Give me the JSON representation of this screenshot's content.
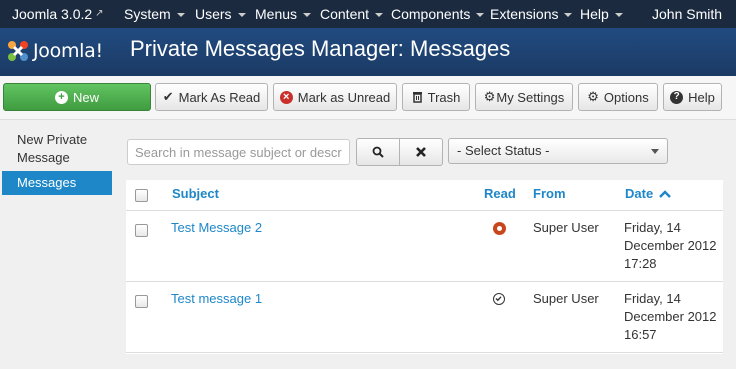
{
  "navbar": {
    "brand": "Joomla 3.0.2",
    "menus": [
      "System",
      "Users",
      "Menus",
      "Content",
      "Components",
      "Extensions",
      "Help"
    ],
    "user": "John Smith"
  },
  "header": {
    "logo_text": "Joomla!",
    "title": "Private Messages Manager: Messages"
  },
  "toolbar": {
    "new": "New",
    "mark_read": "Mark As Read",
    "mark_unread": "Mark as Unread",
    "trash": "Trash",
    "my_settings": "My Settings",
    "options": "Options",
    "help": "Help"
  },
  "sidebar": {
    "new_message": "New Private Message",
    "messages": "Messages"
  },
  "filters": {
    "search_placeholder": "Search in message subject or description",
    "status_select": "- Select Status -"
  },
  "table": {
    "headers": {
      "subject": "Subject",
      "read": "Read",
      "from": "From",
      "date": "Date"
    },
    "rows": [
      {
        "subject": "Test Message 2",
        "read": "unread",
        "from": "Super User",
        "date_1": "Friday, 14",
        "date_2": "December 2012",
        "date_3": "17:28"
      },
      {
        "subject": "Test message 1",
        "read": "read",
        "from": "Super User",
        "date_1": "Friday, 14",
        "date_2": "December 2012",
        "date_3": "16:57"
      }
    ]
  },
  "colors": {
    "navbar": "#1b2a3f",
    "header": "#1f4576",
    "accent": "#1e87c8",
    "new_button": "#51a351",
    "unread": "#c9461c"
  }
}
